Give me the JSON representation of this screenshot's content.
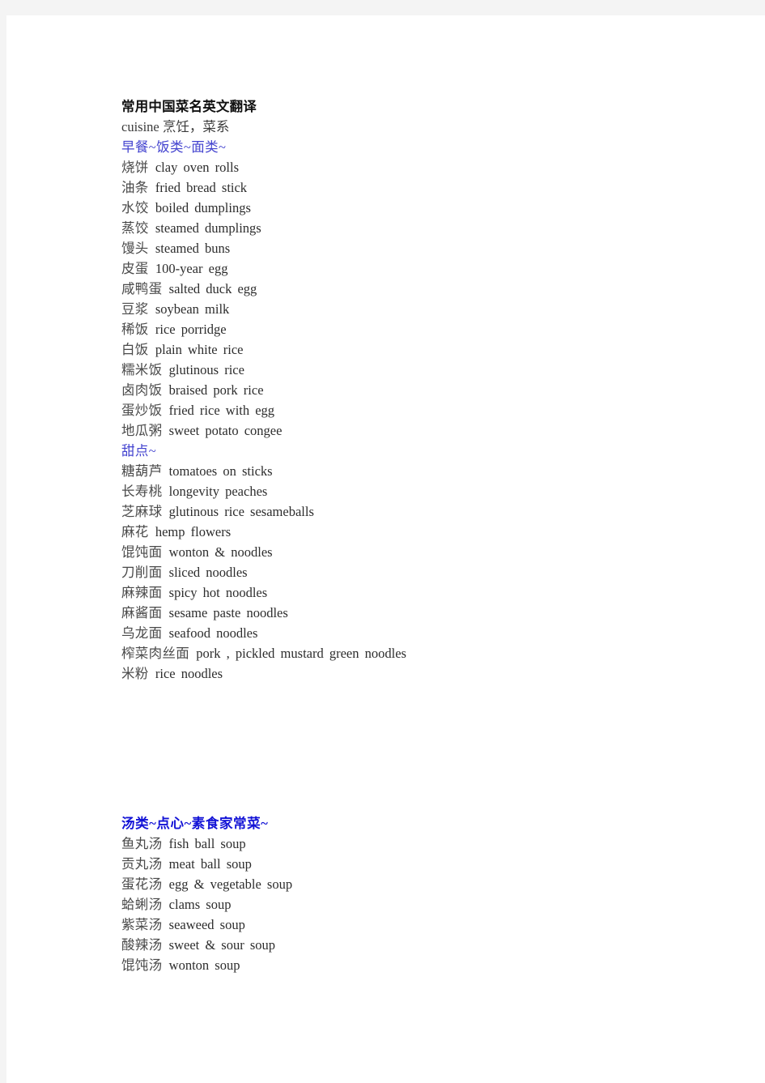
{
  "page": {
    "background_color": "#f4f4f4",
    "paper_color": "#ffffff",
    "title": "常用中国菜名英文翻译",
    "subtitle": "cuisine  烹饪，菜系",
    "body_text_color": "#3b3b3b",
    "section_color": "#4242cf",
    "section_strong_color": "#1313d6"
  },
  "sections": [
    {
      "heading": "早餐~饭类~面类~",
      "heading_style": "normal",
      "entries": [
        {
          "zh": "烧饼",
          "en": "clay oven rolls"
        },
        {
          "zh": "油条",
          "en": "fried bread stick"
        },
        {
          "zh": "水饺",
          "en": "boiled dumplings"
        },
        {
          "zh": "蒸饺",
          "en": "steamed dumplings"
        },
        {
          "zh": "馒头",
          "en": "steamed buns"
        },
        {
          "zh": "皮蛋",
          "en": "100-year egg"
        },
        {
          "zh": "咸鸭蛋",
          "en": "salted duck egg"
        },
        {
          "zh": "豆浆",
          "en": "soybean milk"
        },
        {
          "zh": "稀饭",
          "en": "rice porridge"
        },
        {
          "zh": "白饭",
          "en": "plain white rice"
        },
        {
          "zh": "糯米饭",
          "en": "glutinous rice"
        },
        {
          "zh": "卤肉饭",
          "en": "braised pork rice"
        },
        {
          "zh": "蛋炒饭",
          "en": "fried rice with egg"
        },
        {
          "zh": "地瓜粥",
          "en": "sweet potato congee"
        }
      ]
    },
    {
      "heading": "甜点~",
      "heading_style": "normal",
      "entries": [
        {
          "zh": "糖葫芦",
          "en": "tomatoes on sticks"
        },
        {
          "zh": "长寿桃",
          "en": "longevity peaches"
        },
        {
          "zh": "芝麻球",
          "en": "glutinous rice sesameballs"
        },
        {
          "zh": "麻花",
          "en": "hemp flowers"
        },
        {
          "zh": "馄饨面",
          "en": "wonton & noodles"
        },
        {
          "zh": "刀削面",
          "en": "sliced noodles"
        },
        {
          "zh": "麻辣面",
          "en": "spicy hot noodles"
        },
        {
          "zh": "麻酱面",
          "en": "sesame paste noodles"
        },
        {
          "zh": "乌龙面",
          "en": "seafood noodles"
        },
        {
          "zh": "榨菜肉丝面",
          "en": "pork , pickled mustard green noodles"
        },
        {
          "zh": "米粉",
          "en": "rice noodles"
        }
      ]
    },
    {
      "heading": "汤类~点心~素食家常菜~",
      "heading_style": "bold",
      "entries": [
        {
          "zh": "鱼丸汤",
          "en": "fish ball soup"
        },
        {
          "zh": "贡丸汤",
          "en": "meat ball soup"
        },
        {
          "zh": "蛋花汤",
          "en": "egg & vegetable soup"
        },
        {
          "zh": "蛤蜊汤",
          "en": "clams soup"
        },
        {
          "zh": "紫菜汤",
          "en": "seaweed soup"
        },
        {
          "zh": "酸辣汤",
          "en": "sweet & sour soup"
        },
        {
          "zh": "馄饨汤",
          "en": "wonton soup"
        }
      ]
    }
  ]
}
